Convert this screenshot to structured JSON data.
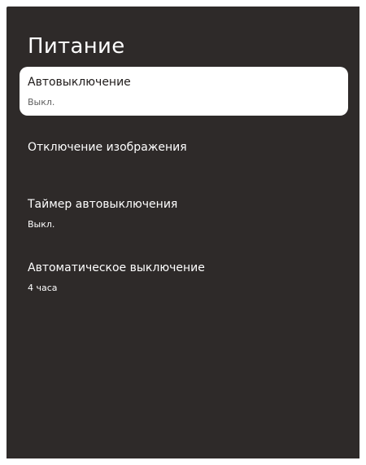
{
  "screen": {
    "title": "Питание"
  },
  "menu": {
    "items": [
      {
        "label": "Автовыключение",
        "value": "Выкл.",
        "selected": true
      },
      {
        "label": "Отключение изображения",
        "value": "",
        "selected": false
      },
      {
        "label": "Таймер автовыключения",
        "value": "Выкл.",
        "selected": false
      },
      {
        "label": "Автоматическое выключение",
        "value": "4 часа",
        "selected": false
      }
    ]
  },
  "colors": {
    "background": "#2e2a29",
    "text_primary": "#ffffff",
    "selected_background": "#ffffff",
    "selected_text": "#1f1b1a",
    "selected_value_text": "#5f5f5f"
  }
}
